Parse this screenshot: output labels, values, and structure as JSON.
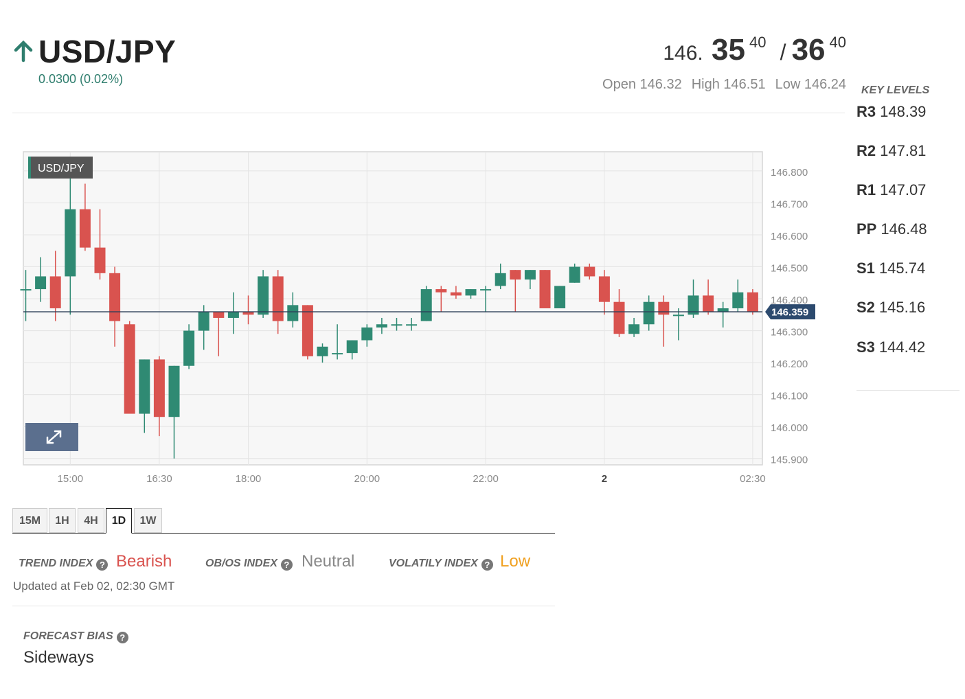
{
  "header": {
    "pair": "USD/JPY",
    "change": "0.0300 (0.02%)",
    "bid_main": "146.",
    "bid_big": "35",
    "bid_pip": "40",
    "slash": "/",
    "ask_big": "36",
    "ask_pip": "40",
    "open": "Open 146.32",
    "high": "High 146.51",
    "low": "Low 146.24",
    "arrow_icon": "arrow-up-icon",
    "up_color": "#2f7e6e"
  },
  "key_levels": {
    "title": "KEY LEVELS",
    "levels": [
      {
        "label": "R3",
        "value": "148.39"
      },
      {
        "label": "R2",
        "value": "147.81"
      },
      {
        "label": "R1",
        "value": "147.07"
      },
      {
        "label": "PP",
        "value": "146.48"
      },
      {
        "label": "S1",
        "value": "145.74"
      },
      {
        "label": "S2",
        "value": "145.16"
      },
      {
        "label": "S3",
        "value": "144.42"
      }
    ]
  },
  "chart_data": {
    "type": "candlestick",
    "badge": "USD/JPY",
    "current_price_label": "146.359",
    "current_price": 146.359,
    "ylim": [
      145.88,
      146.86
    ],
    "y_ticks": [
      "146.800",
      "146.700",
      "146.600",
      "146.500",
      "146.400",
      "146.300",
      "146.200",
      "146.100",
      "146.000",
      "145.900"
    ],
    "x_ticks": [
      {
        "label": "15:00",
        "i": 3
      },
      {
        "label": "16:30",
        "i": 9
      },
      {
        "label": "18:00",
        "i": 15
      },
      {
        "label": "20:00",
        "i": 23
      },
      {
        "label": "22:00",
        "i": 31
      },
      {
        "label": "2",
        "i": 39
      },
      {
        "label": "02:30",
        "i": 49
      }
    ],
    "bull_color": "#2f8a73",
    "bear_color": "#d9534f",
    "candles": [
      {
        "o": 146.43,
        "h": 146.49,
        "l": 146.33,
        "c": 146.43
      },
      {
        "o": 146.43,
        "h": 146.53,
        "l": 146.39,
        "c": 146.47
      },
      {
        "o": 146.47,
        "h": 146.55,
        "l": 146.33,
        "c": 146.37
      },
      {
        "o": 146.47,
        "h": 146.84,
        "l": 146.35,
        "c": 146.68
      },
      {
        "o": 146.68,
        "h": 146.76,
        "l": 146.55,
        "c": 146.56
      },
      {
        "o": 146.56,
        "h": 146.68,
        "l": 146.46,
        "c": 146.48
      },
      {
        "o": 146.48,
        "h": 146.5,
        "l": 146.25,
        "c": 146.33
      },
      {
        "o": 146.32,
        "h": 146.33,
        "l": 146.04,
        "c": 146.04
      },
      {
        "o": 146.04,
        "h": 146.21,
        "l": 145.98,
        "c": 146.21
      },
      {
        "o": 146.21,
        "h": 146.22,
        "l": 145.97,
        "c": 146.03
      },
      {
        "o": 146.03,
        "h": 146.19,
        "l": 145.9,
        "c": 146.19
      },
      {
        "o": 146.19,
        "h": 146.32,
        "l": 146.18,
        "c": 146.3
      },
      {
        "o": 146.3,
        "h": 146.38,
        "l": 146.24,
        "c": 146.36
      },
      {
        "o": 146.36,
        "h": 146.36,
        "l": 146.22,
        "c": 146.34
      },
      {
        "o": 146.34,
        "h": 146.42,
        "l": 146.29,
        "c": 146.36
      },
      {
        "o": 146.36,
        "h": 146.41,
        "l": 146.32,
        "c": 146.35
      },
      {
        "o": 146.35,
        "h": 146.49,
        "l": 146.34,
        "c": 146.47
      },
      {
        "o": 146.47,
        "h": 146.49,
        "l": 146.29,
        "c": 146.33
      },
      {
        "o": 146.33,
        "h": 146.42,
        "l": 146.31,
        "c": 146.38
      },
      {
        "o": 146.38,
        "h": 146.38,
        "l": 146.21,
        "c": 146.22
      },
      {
        "o": 146.22,
        "h": 146.26,
        "l": 146.2,
        "c": 146.25
      },
      {
        "o": 146.23,
        "h": 146.32,
        "l": 146.21,
        "c": 146.23
      },
      {
        "o": 146.23,
        "h": 146.27,
        "l": 146.21,
        "c": 146.27
      },
      {
        "o": 146.27,
        "h": 146.32,
        "l": 146.25,
        "c": 146.31
      },
      {
        "o": 146.31,
        "h": 146.34,
        "l": 146.29,
        "c": 146.32
      },
      {
        "o": 146.32,
        "h": 146.34,
        "l": 146.3,
        "c": 146.32
      },
      {
        "o": 146.32,
        "h": 146.34,
        "l": 146.3,
        "c": 146.32
      },
      {
        "o": 146.33,
        "h": 146.44,
        "l": 146.33,
        "c": 146.43
      },
      {
        "o": 146.43,
        "h": 146.44,
        "l": 146.36,
        "c": 146.42
      },
      {
        "o": 146.42,
        "h": 146.44,
        "l": 146.4,
        "c": 146.41
      },
      {
        "o": 146.41,
        "h": 146.43,
        "l": 146.4,
        "c": 146.43
      },
      {
        "o": 146.43,
        "h": 146.44,
        "l": 146.36,
        "c": 146.43
      },
      {
        "o": 146.44,
        "h": 146.51,
        "l": 146.43,
        "c": 146.48
      },
      {
        "o": 146.49,
        "h": 146.49,
        "l": 146.36,
        "c": 146.46
      },
      {
        "o": 146.46,
        "h": 146.49,
        "l": 146.43,
        "c": 146.49
      },
      {
        "o": 146.49,
        "h": 146.49,
        "l": 146.37,
        "c": 146.37
      },
      {
        "o": 146.37,
        "h": 146.44,
        "l": 146.37,
        "c": 146.44
      },
      {
        "o": 146.45,
        "h": 146.51,
        "l": 146.45,
        "c": 146.5
      },
      {
        "o": 146.5,
        "h": 146.51,
        "l": 146.46,
        "c": 146.47
      },
      {
        "o": 146.47,
        "h": 146.49,
        "l": 146.35,
        "c": 146.39
      },
      {
        "o": 146.39,
        "h": 146.43,
        "l": 146.28,
        "c": 146.29
      },
      {
        "o": 146.29,
        "h": 146.34,
        "l": 146.28,
        "c": 146.32
      },
      {
        "o": 146.32,
        "h": 146.41,
        "l": 146.3,
        "c": 146.39
      },
      {
        "o": 146.39,
        "h": 146.41,
        "l": 146.25,
        "c": 146.35
      },
      {
        "o": 146.35,
        "h": 146.37,
        "l": 146.27,
        "c": 146.35
      },
      {
        "o": 146.35,
        "h": 146.46,
        "l": 146.34,
        "c": 146.41
      },
      {
        "o": 146.41,
        "h": 146.46,
        "l": 146.35,
        "c": 146.36
      },
      {
        "o": 146.36,
        "h": 146.39,
        "l": 146.31,
        "c": 146.37
      },
      {
        "o": 146.37,
        "h": 146.46,
        "l": 146.36,
        "c": 146.42
      },
      {
        "o": 146.42,
        "h": 146.43,
        "l": 146.35,
        "c": 146.36
      }
    ]
  },
  "tabs": [
    {
      "label": "15M",
      "active": false
    },
    {
      "label": "1H",
      "active": false
    },
    {
      "label": "4H",
      "active": false
    },
    {
      "label": "1D",
      "active": true
    },
    {
      "label": "1W",
      "active": false
    }
  ],
  "indices": {
    "trend_label": "TREND INDEX",
    "trend_value": "Bearish",
    "trend_color": "#d9534f",
    "obos_label": "OB/OS INDEX",
    "obos_value": "Neutral",
    "obos_color": "#888888",
    "vol_label": "VOLATILY INDEX",
    "vol_value": "Low",
    "vol_color": "#f0a020",
    "help_icon": "question-circle-icon",
    "updated": "Updated at Feb 02, 02:30 GMT"
  },
  "forecast": {
    "label": "FORECAST BIAS",
    "value": "Sideways"
  }
}
